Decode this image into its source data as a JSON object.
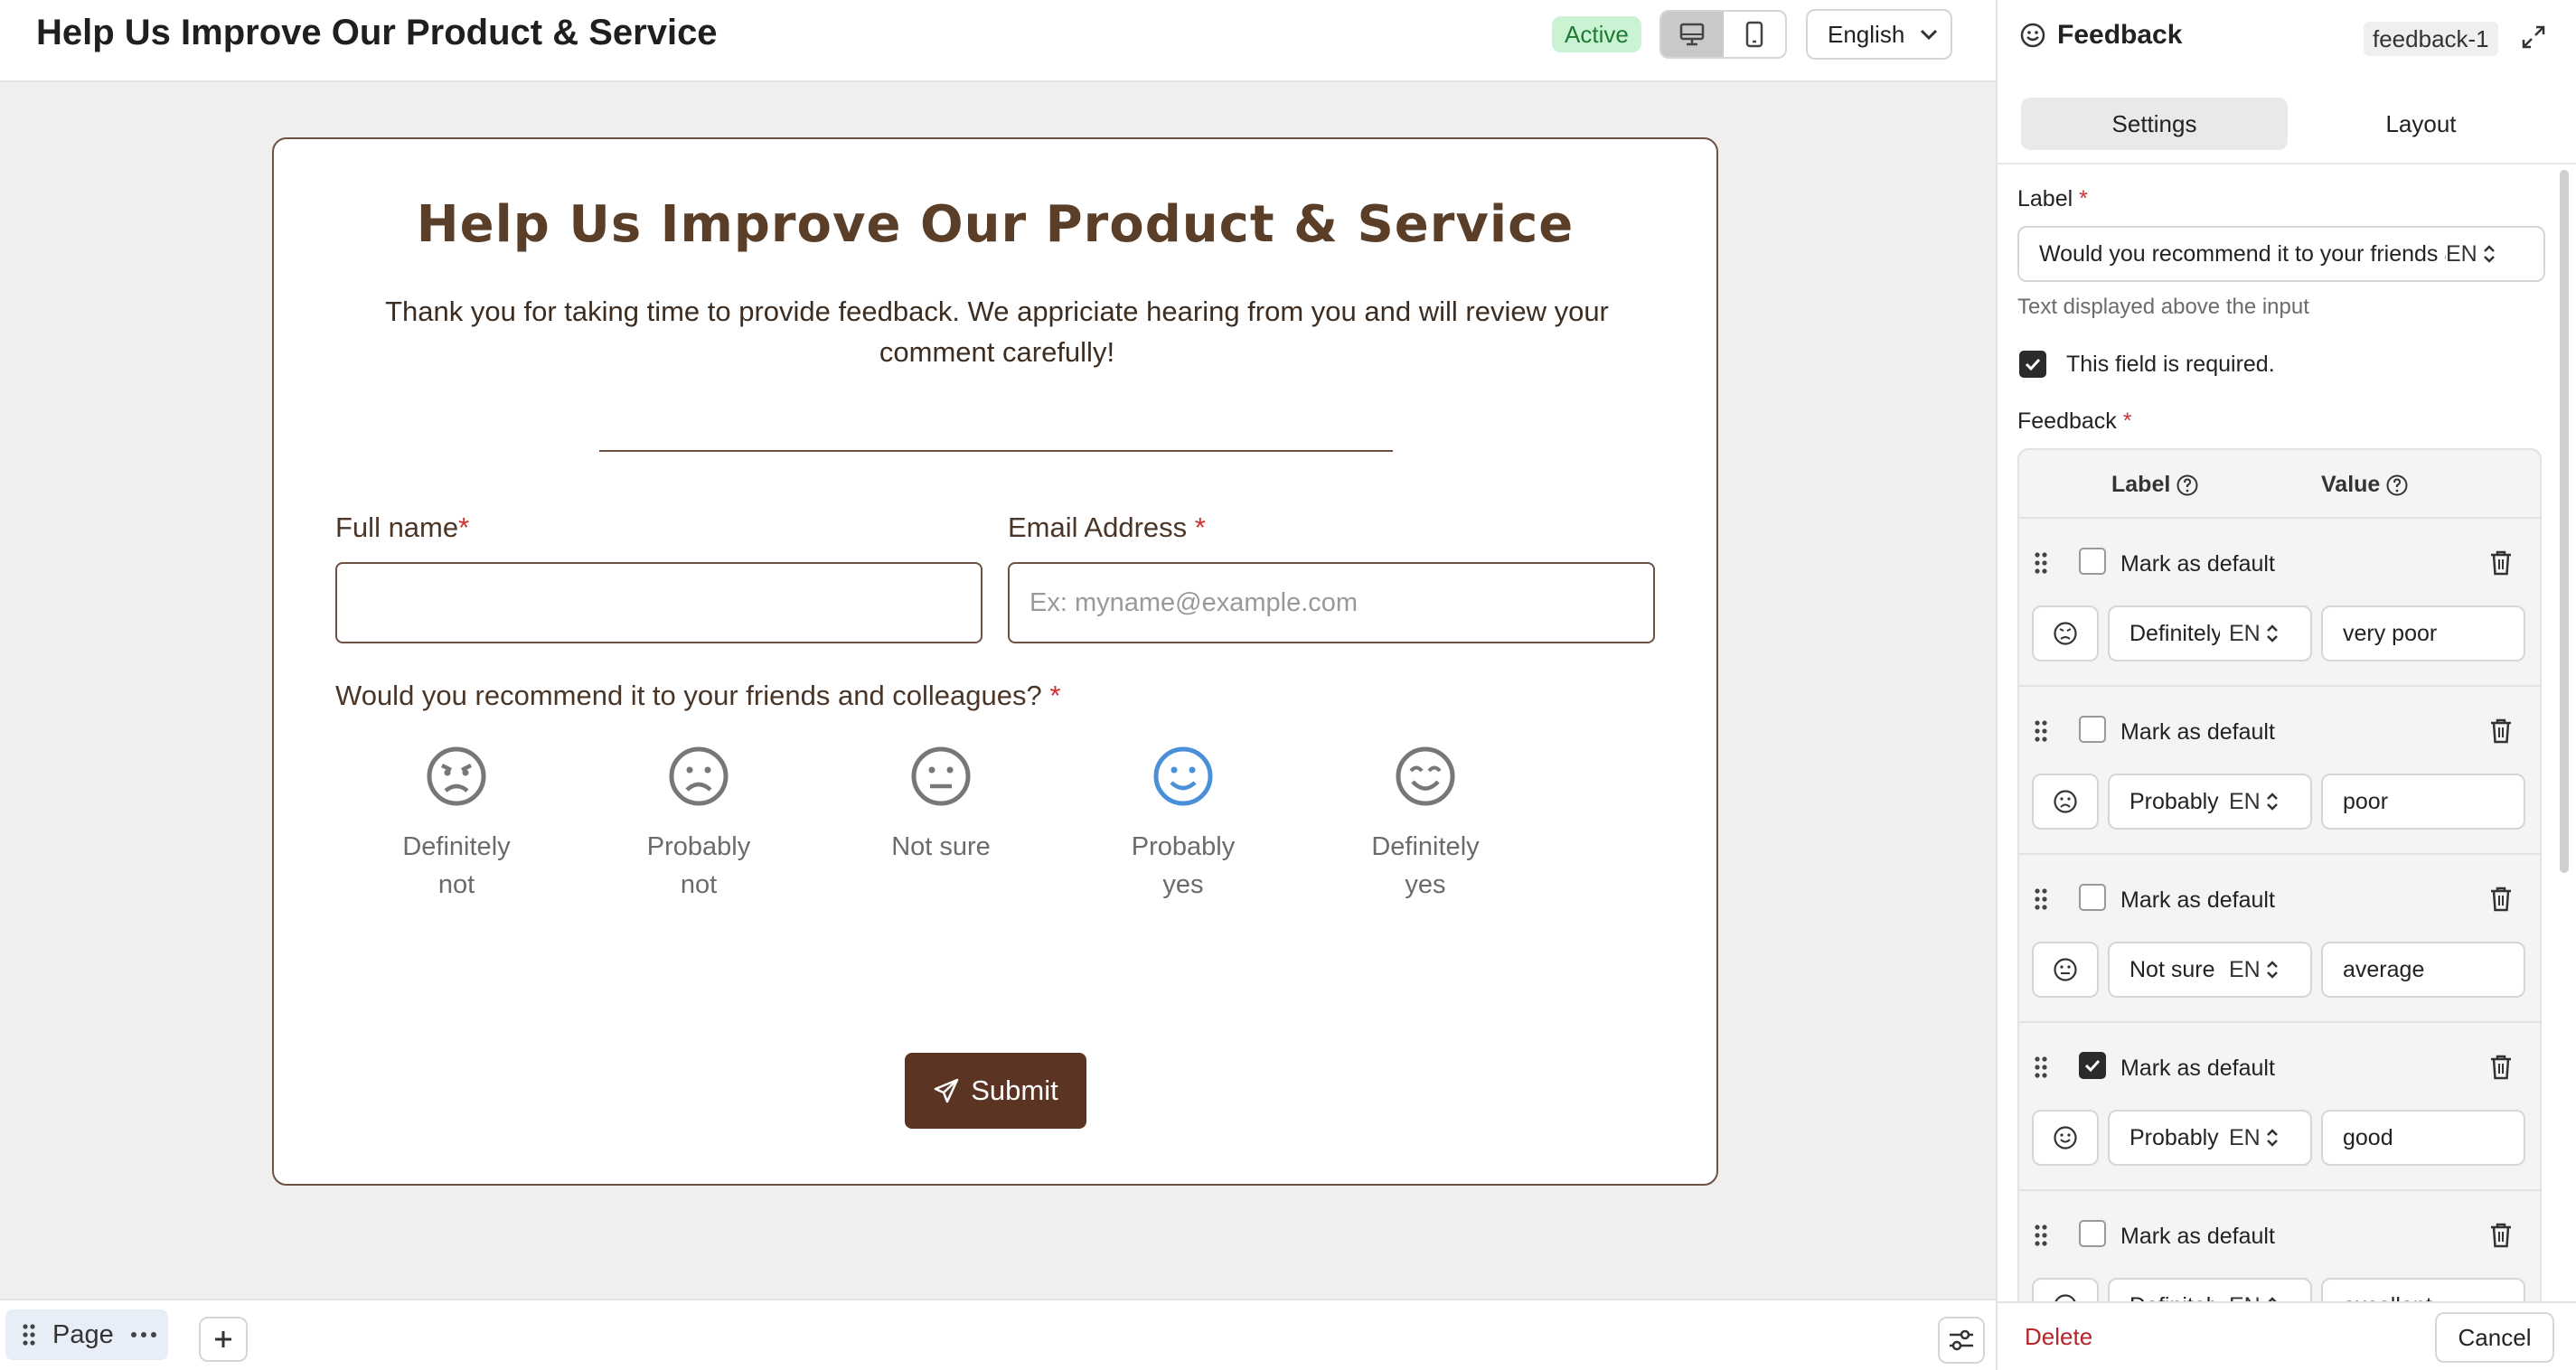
{
  "topbar": {
    "title": "Help Us Improve Our Product & Service",
    "status": "Active",
    "language": "English"
  },
  "form": {
    "title": "Help Us Improve Our Product & Service",
    "description": "Thank you for taking time to provide feedback. We appriciate hearing from you and will review your comment carefully!",
    "full_name_label": "Full name",
    "email_label": "Email Address",
    "email_placeholder": "Ex: myname@example.com",
    "required_mark": "*",
    "question": "Would you recommend it to your friends and colleagues?",
    "options": [
      {
        "line1": "Definitely",
        "line2": "not",
        "icon": "angry-face-icon"
      },
      {
        "line1": "Probably",
        "line2": "not",
        "icon": "frown-face-icon"
      },
      {
        "line1": "Not sure",
        "line2": "",
        "icon": "neutral-face-icon"
      },
      {
        "line1": "Probably",
        "line2": "yes",
        "icon": "smile-face-icon"
      },
      {
        "line1": "Definitely",
        "line2": "yes",
        "icon": "grin-face-icon"
      }
    ],
    "submit_label": "Submit"
  },
  "bottombar": {
    "page_label": "Page"
  },
  "panel": {
    "title": "Feedback",
    "id": "feedback-1",
    "tabs": [
      {
        "label": "Settings"
      },
      {
        "label": "Layout"
      }
    ],
    "label_title": "Label",
    "label_value": "Would you recommend it to your friends and colleagues?",
    "lang_code": "EN",
    "help_text": "Text displayed above the input",
    "required_text": "This field is required.",
    "feedback_title": "Feedback",
    "col_label": "Label",
    "col_value": "Value",
    "mark_default": "Mark as default",
    "rows": [
      {
        "label": "Definitely not",
        "value": "very poor",
        "checked": false
      },
      {
        "label": "Probably not",
        "value": "poor",
        "checked": false
      },
      {
        "label": "Not sure",
        "value": "average",
        "checked": false
      },
      {
        "label": "Probably yes",
        "value": "good",
        "checked": true
      },
      {
        "label": "Definitely yes",
        "value": "excellent",
        "checked": false
      }
    ],
    "delete_label": "Delete",
    "cancel_label": "Cancel"
  },
  "colors": {
    "brand": "#5b3424",
    "highlight": "#4a90d9",
    "active_bg": "#c9f3d2",
    "danger": "#b3262b"
  }
}
